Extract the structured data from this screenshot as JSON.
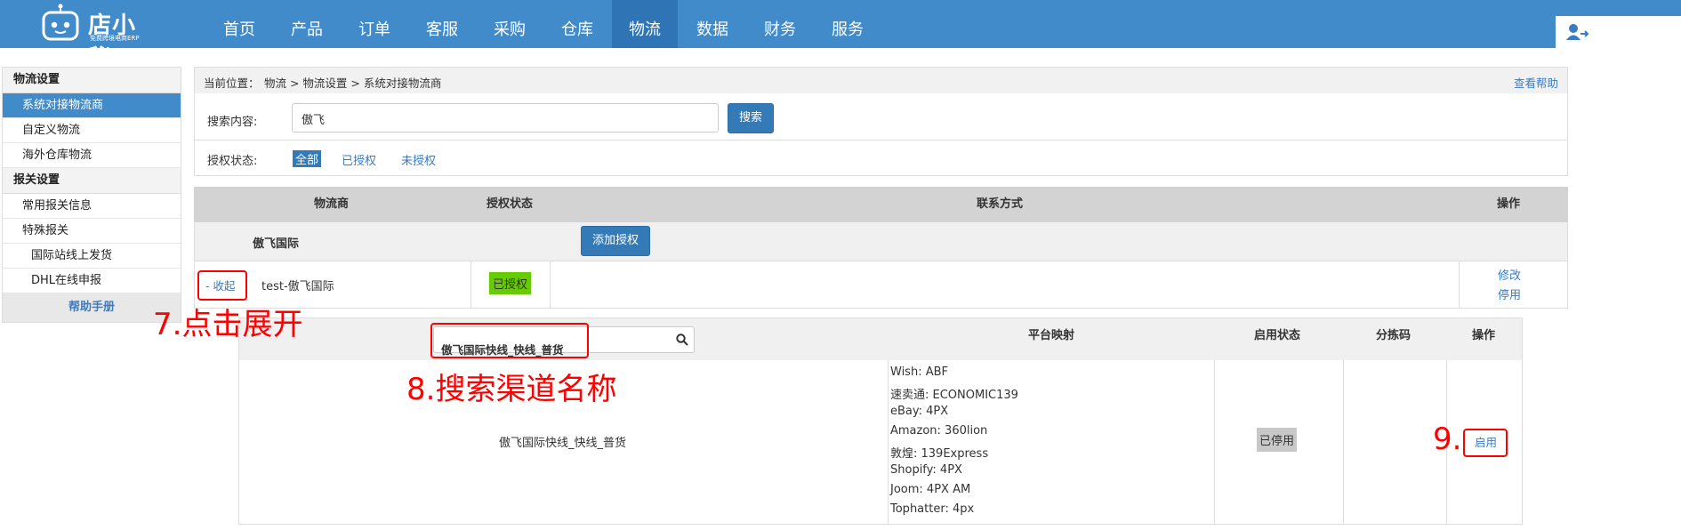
{
  "header": {
    "brand": "店小秘",
    "brand_sub": "免费跨境电商ERP",
    "nav": [
      "首页",
      "产品",
      "订单",
      "客服",
      "采购",
      "仓库",
      "物流",
      "数据",
      "财务",
      "服务"
    ],
    "active_nav": "物流"
  },
  "sidebar": {
    "sections": [
      {
        "title": "物流设置",
        "items": [
          "系统对接物流商",
          "自定义物流",
          "海外仓库物流"
        ]
      },
      {
        "title": "报关设置",
        "items": [
          "常用报关信息",
          "特殊报关"
        ],
        "subitems": [
          "国际站线上发货",
          "DHL在线申报"
        ]
      }
    ],
    "help": "帮助手册"
  },
  "breadcrumb": {
    "prefix": "当前位置：",
    "path": "物流 >  物流设置 > 系统对接物流商",
    "help_link": "查看帮助"
  },
  "search": {
    "label": "搜索内容:",
    "value": "傲飞",
    "button": "搜索",
    "auth_label": "授权状态:",
    "filters": [
      "全部",
      "已授权",
      "未授权"
    ]
  },
  "table": {
    "headers": [
      "物流商",
      "授权状态",
      "联系方式",
      "操作"
    ],
    "group_name": "傲飞国际",
    "add_auth": "添加授权",
    "row": {
      "toggle": "- 收起",
      "name": "test-傲飞国际",
      "status": "已授权",
      "actions": [
        "修改",
        "停用"
      ]
    }
  },
  "channel_table": {
    "search_value": "傲飞国际快线_快线_普货",
    "headers": [
      "平台映射",
      "启用状态",
      "分拣码",
      "操作"
    ],
    "row": {
      "name": "傲飞国际快线_快线_普货",
      "mappings": [
        "Wish:  ABF",
        "速卖通:  ECONOMIC139",
        "eBay:  4PX",
        "Amazon:  360lion",
        "敦煌:  139Express",
        "Shopify:  4PX",
        "Joom:  4PX AM",
        "Tophatter:  4px"
      ],
      "status": "已停用",
      "action": "启用"
    }
  },
  "annotations": [
    "7.点击展开",
    "8.搜索渠道名称",
    "9."
  ],
  "colors": {
    "primary": "#428bca",
    "annotation": "#ff0000",
    "authorized": "#66cc00"
  }
}
